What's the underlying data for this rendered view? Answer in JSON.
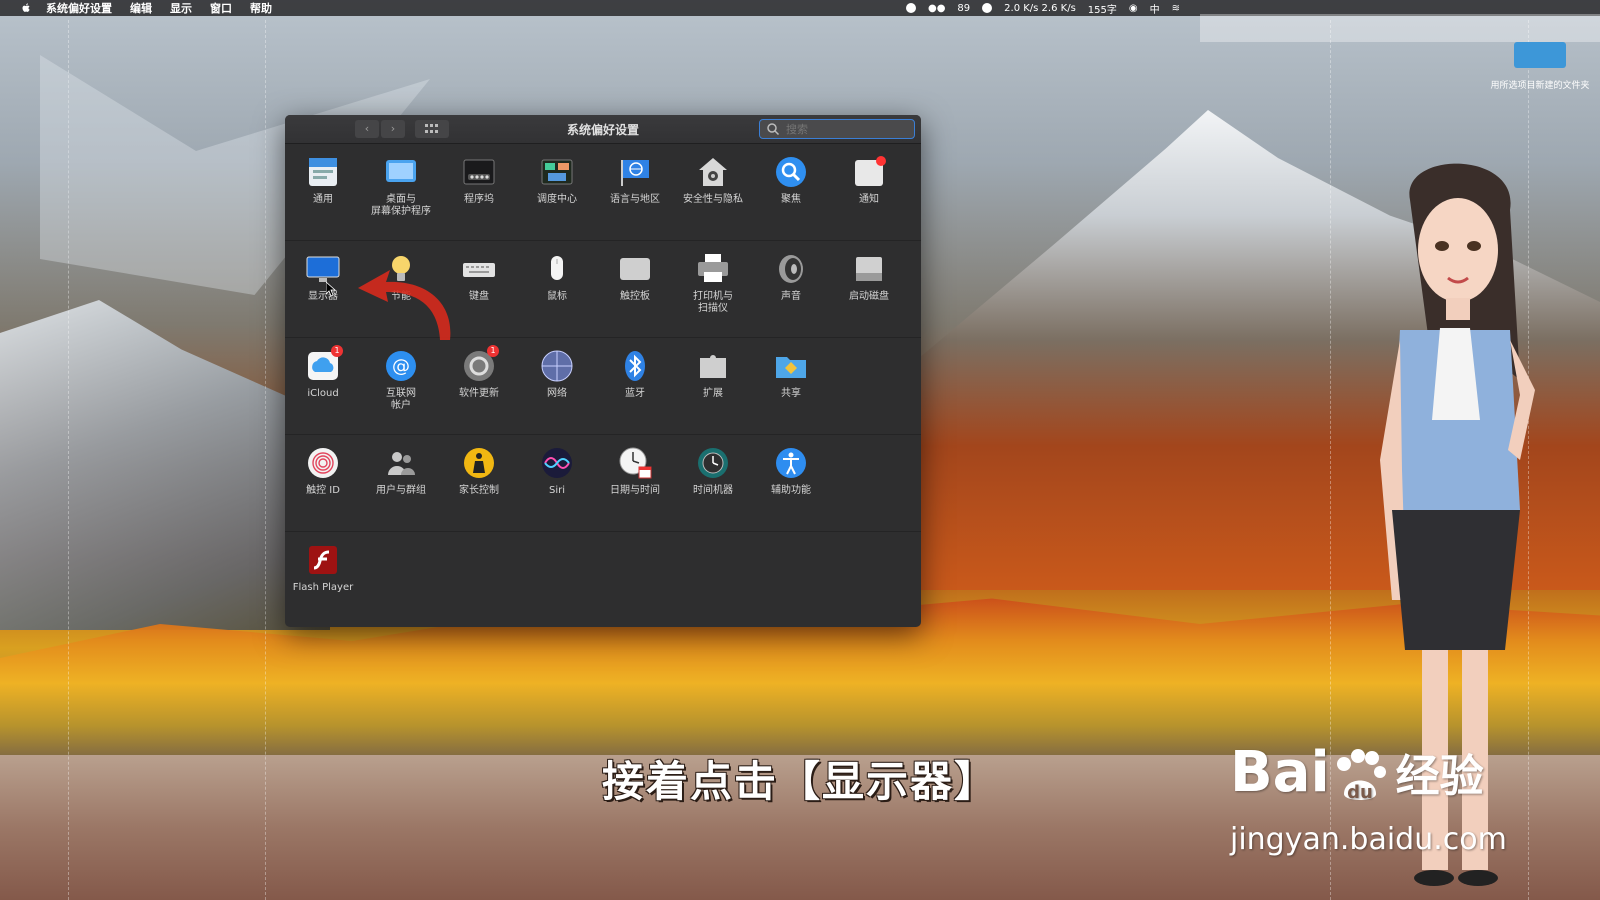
{
  "menubar": {
    "app_name": "系统偏好设置",
    "items": [
      "编辑",
      "显示",
      "窗口",
      "帮助"
    ],
    "status": {
      "battery": "89",
      "net_speed": "2.0 K/s 2.6 K/s",
      "word_count": "155字",
      "ime": "中"
    }
  },
  "desktop": {
    "folder_label": "用所选项目新建的文件夹"
  },
  "window": {
    "title": "系统偏好设置",
    "search_placeholder": "搜索",
    "rows": [
      [
        {
          "label": "通用",
          "icon": "general-icon"
        },
        {
          "label": "桌面与\n屏幕保护程序",
          "icon": "desktop-icon"
        },
        {
          "label": "程序坞",
          "icon": "dock-icon"
        },
        {
          "label": "调度中心",
          "icon": "mission-control-icon"
        },
        {
          "label": "语言与地区",
          "icon": "language-icon"
        },
        {
          "label": "安全性与隐私",
          "icon": "security-icon"
        },
        {
          "label": "聚焦",
          "icon": "spotlight-icon"
        },
        {
          "label": "通知",
          "icon": "notifications-icon"
        }
      ],
      [
        {
          "label": "显示器",
          "icon": "display-icon"
        },
        {
          "label": "节能",
          "icon": "energy-icon"
        },
        {
          "label": "键盘",
          "icon": "keyboard-icon"
        },
        {
          "label": "鼠标",
          "icon": "mouse-icon"
        },
        {
          "label": "触控板",
          "icon": "trackpad-icon"
        },
        {
          "label": "打印机与\n扫描仪",
          "icon": "printer-icon"
        },
        {
          "label": "声音",
          "icon": "sound-icon"
        },
        {
          "label": "启动磁盘",
          "icon": "startup-disk-icon"
        }
      ],
      [
        {
          "label": "iCloud",
          "icon": "icloud-icon",
          "badge": "1"
        },
        {
          "label": "互联网\n帐户",
          "icon": "internet-accounts-icon"
        },
        {
          "label": "软件更新",
          "icon": "software-update-icon",
          "badge": "1"
        },
        {
          "label": "网络",
          "icon": "network-icon"
        },
        {
          "label": "蓝牙",
          "icon": "bluetooth-icon"
        },
        {
          "label": "扩展",
          "icon": "extensions-icon"
        },
        {
          "label": "共享",
          "icon": "sharing-icon"
        }
      ],
      [
        {
          "label": "触控 ID",
          "icon": "touch-id-icon"
        },
        {
          "label": "用户与群组",
          "icon": "users-icon"
        },
        {
          "label": "家长控制",
          "icon": "parental-controls-icon"
        },
        {
          "label": "Siri",
          "icon": "siri-icon"
        },
        {
          "label": "日期与时间",
          "icon": "date-time-icon"
        },
        {
          "label": "时间机器",
          "icon": "time-machine-icon"
        },
        {
          "label": "辅助功能",
          "icon": "accessibility-icon"
        }
      ],
      [
        {
          "label": "Flash Player",
          "icon": "flash-player-icon"
        }
      ]
    ]
  },
  "subtitle": "接着点击【显示器】",
  "watermark": {
    "brand": "Bai",
    "brand2": "经验",
    "url": "jingyan.baidu.com"
  }
}
